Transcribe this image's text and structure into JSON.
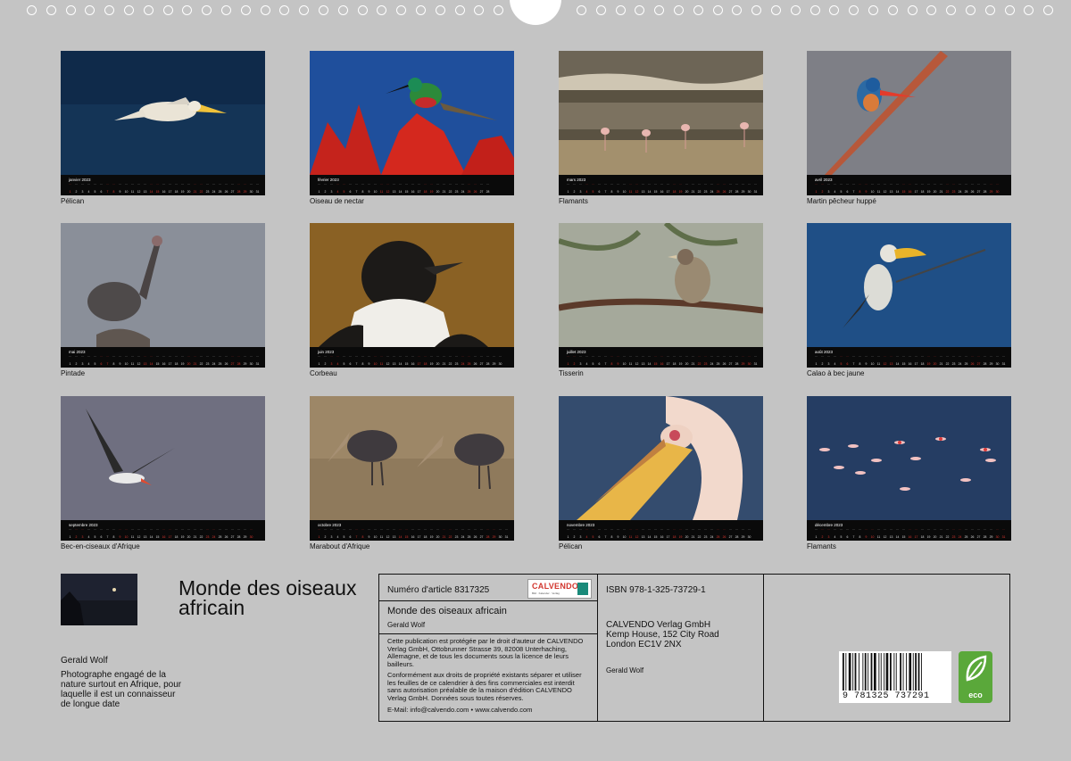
{
  "months": [
    {
      "id": "jan",
      "label": "janvier 2023",
      "caption": "Pélican",
      "days": 31,
      "weekends": [
        1,
        7,
        8,
        14,
        15,
        21,
        22,
        28,
        29
      ]
    },
    {
      "id": "feb",
      "label": "février 2023",
      "caption": "Oiseau de nectar",
      "days": 28,
      "weekends": [
        4,
        5,
        11,
        12,
        18,
        19,
        25,
        26
      ]
    },
    {
      "id": "mar",
      "label": "mars 2023",
      "caption": "Flamants",
      "days": 31,
      "weekends": [
        4,
        5,
        11,
        12,
        18,
        19,
        25,
        26
      ]
    },
    {
      "id": "apr",
      "label": "avril 2023",
      "caption": "Martin pêcheur huppé",
      "days": 30,
      "weekends": [
        1,
        2,
        8,
        9,
        15,
        16,
        22,
        23,
        29,
        30
      ]
    },
    {
      "id": "may",
      "label": "mai 2023",
      "caption": "Pintade",
      "days": 31,
      "weekends": [
        6,
        7,
        13,
        14,
        20,
        21,
        27,
        28
      ]
    },
    {
      "id": "jun",
      "label": "juin 2023",
      "caption": "Corbeau",
      "days": 30,
      "weekends": [
        3,
        4,
        10,
        11,
        17,
        18,
        24,
        25
      ]
    },
    {
      "id": "jul",
      "label": "juillet 2023",
      "caption": "Tisserin",
      "days": 31,
      "weekends": [
        1,
        2,
        8,
        9,
        15,
        16,
        22,
        23,
        29,
        30
      ]
    },
    {
      "id": "aug",
      "label": "août 2023",
      "caption": "Calao à bec jaune",
      "days": 31,
      "weekends": [
        5,
        6,
        12,
        13,
        19,
        20,
        26,
        27
      ]
    },
    {
      "id": "sep",
      "label": "septembre 2023",
      "caption": "Bec-en-ciseaux d'Afrique",
      "days": 30,
      "weekends": [
        2,
        3,
        9,
        10,
        16,
        17,
        23,
        24,
        30
      ]
    },
    {
      "id": "oct",
      "label": "octobre 2023",
      "caption": "Marabout d'Afrique",
      "days": 31,
      "weekends": [
        1,
        7,
        8,
        14,
        15,
        21,
        22,
        28,
        29
      ]
    },
    {
      "id": "nov",
      "label": "novembre 2023",
      "caption": "Pélican",
      "days": 30,
      "weekends": [
        4,
        5,
        11,
        12,
        18,
        19,
        25,
        26
      ]
    },
    {
      "id": "dec",
      "label": "décembre 2023",
      "caption": "Flamants",
      "days": 31,
      "weekends": [
        2,
        3,
        9,
        10,
        16,
        17,
        23,
        24,
        30,
        31
      ]
    }
  ],
  "title": "Monde des oiseaux africain",
  "author": {
    "name": "Gerald Wolf",
    "description": "Photographe engagé de la nature surtout en Afrique, pour laquelle il est un connaisseur de longue date"
  },
  "info": {
    "article": "Numéro d'article 8317325",
    "logo_name": "CALVENDO",
    "logo_sub": "Bild · Kalender · Verlag",
    "product_title": "Monde des oiseaux africain",
    "product_author": "Gerald Wolf",
    "copyright": "Cette publication est protégée par le droit d'auteur de CALVENDO Verlag GmbH, Ottobrunner Strasse 39, 82008 Unterhaching, Allemagne, et de tous les documents sous la licence de leurs bailleurs.",
    "rights": "Conformément aux droits de propriété existants séparer et utiliser les feuilles de ce calendrier à des fins commerciales est interdit sans autorisation préalable de la maison d'édition CALVENDO Verlag GmbH. Données sous toutes réserves.",
    "contact": "E-Mail: info@calvendo.com • www.calvendo.com",
    "isbn": "ISBN 978-1-325-73729-1",
    "publisher_line1": "CALVENDO Verlag GmbH",
    "publisher_line2": "Kemp House, 152 City Road",
    "publisher_line3": "London EC1V 2NX",
    "publisher_author": "Gerald Wolf",
    "barcode_digits": "9 781325 737291",
    "eco_label": "eco"
  }
}
